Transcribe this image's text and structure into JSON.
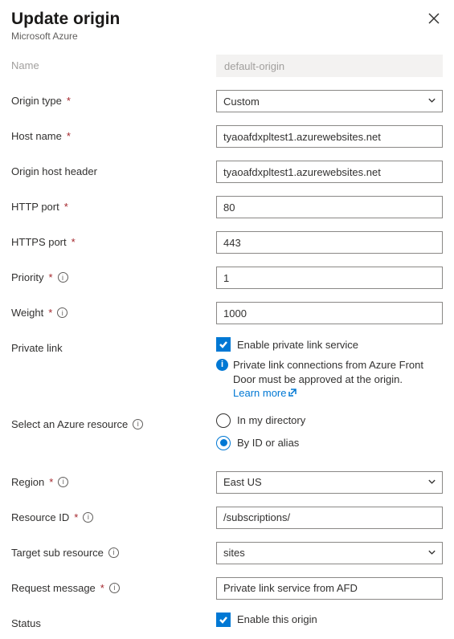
{
  "header": {
    "title": "Update origin",
    "subtitle": "Microsoft Azure"
  },
  "fields": {
    "name": {
      "label": "Name",
      "value": "default-origin"
    },
    "origin_type": {
      "label": "Origin type",
      "value": "Custom"
    },
    "host_name": {
      "label": "Host name",
      "value": "tyaoafdxpltest1.azurewebsites.net"
    },
    "origin_host_header": {
      "label": "Origin host header",
      "value": "tyaoafdxpltest1.azurewebsites.net"
    },
    "http_port": {
      "label": "HTTP port",
      "value": "80"
    },
    "https_port": {
      "label": "HTTPS port",
      "value": "443"
    },
    "priority": {
      "label": "Priority",
      "value": "1"
    },
    "weight": {
      "label": "Weight",
      "value": "1000"
    },
    "private_link": {
      "label": "Private link",
      "checkbox_label": "Enable private link service",
      "info_msg": "Private link connections from Azure Front Door must be approved at the origin.",
      "learn_more": "Learn more"
    },
    "select_resource": {
      "label": "Select an Azure resource",
      "option_directory": "In my directory",
      "option_id": "By ID or alias"
    },
    "region": {
      "label": "Region",
      "value": "East US"
    },
    "resource_id": {
      "label": "Resource ID",
      "value": "/subscriptions/"
    },
    "target_sub": {
      "label": "Target sub resource",
      "value": "sites"
    },
    "request_msg": {
      "label": "Request message",
      "value": "Private link service from AFD"
    },
    "status": {
      "label": "Status",
      "checkbox_label": "Enable this origin"
    }
  }
}
